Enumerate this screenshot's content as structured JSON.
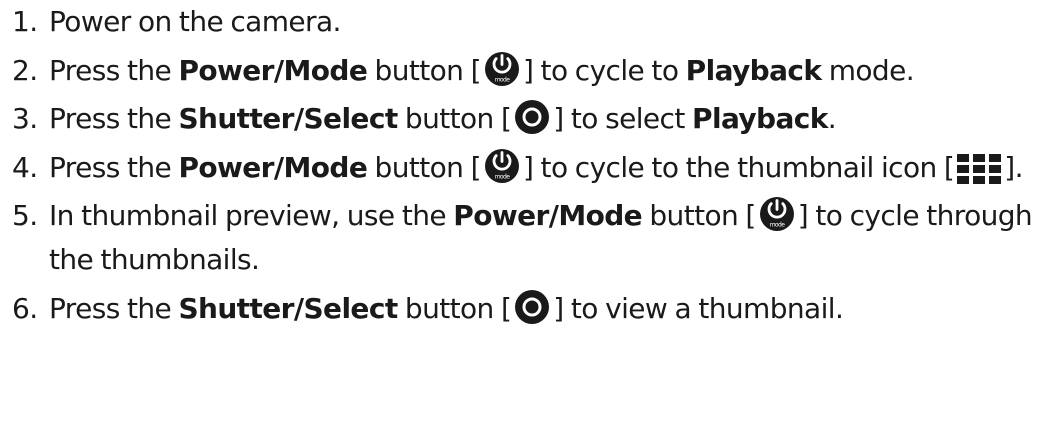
{
  "steps": [
    {
      "num": "1.",
      "parts": [
        "Power on the camera."
      ]
    },
    {
      "num": "2.",
      "parts": [
        "Press the ",
        "Power/Mode",
        " button [",
        "] to cycle to ",
        "Playback",
        " mode."
      ],
      "icon": "power-mode-icon",
      "icon_label": "mode"
    },
    {
      "num": "3.",
      "parts": [
        "Press the ",
        "Shutter/Select",
        " button [",
        "] to select ",
        "Playback",
        "."
      ],
      "icon": "shutter-select-icon"
    },
    {
      "num": "4.",
      "parts": [
        "Press the ",
        "Power/Mode",
        " button [",
        "] to cycle to the thumbnail icon [",
        "]."
      ],
      "icons": [
        "power-mode-icon",
        "thumbnail-grid-icon"
      ],
      "icon_label": "mode"
    },
    {
      "num": "5.",
      "parts": [
        "In thumbnail preview, use the ",
        "Power/Mode",
        " button [",
        "] to cycle through the thumbnails."
      ],
      "icon": "power-mode-icon",
      "icon_label": "mode"
    },
    {
      "num": "6.",
      "parts": [
        "Press the ",
        "Shutter/Select",
        " button [",
        "] to view a thumbnail."
      ],
      "icon": "shutter-select-icon"
    }
  ],
  "colors": {
    "text": "#1a1a1a",
    "icon_fill": "#1a1a1a",
    "icon_glyph": "#ffffff"
  }
}
